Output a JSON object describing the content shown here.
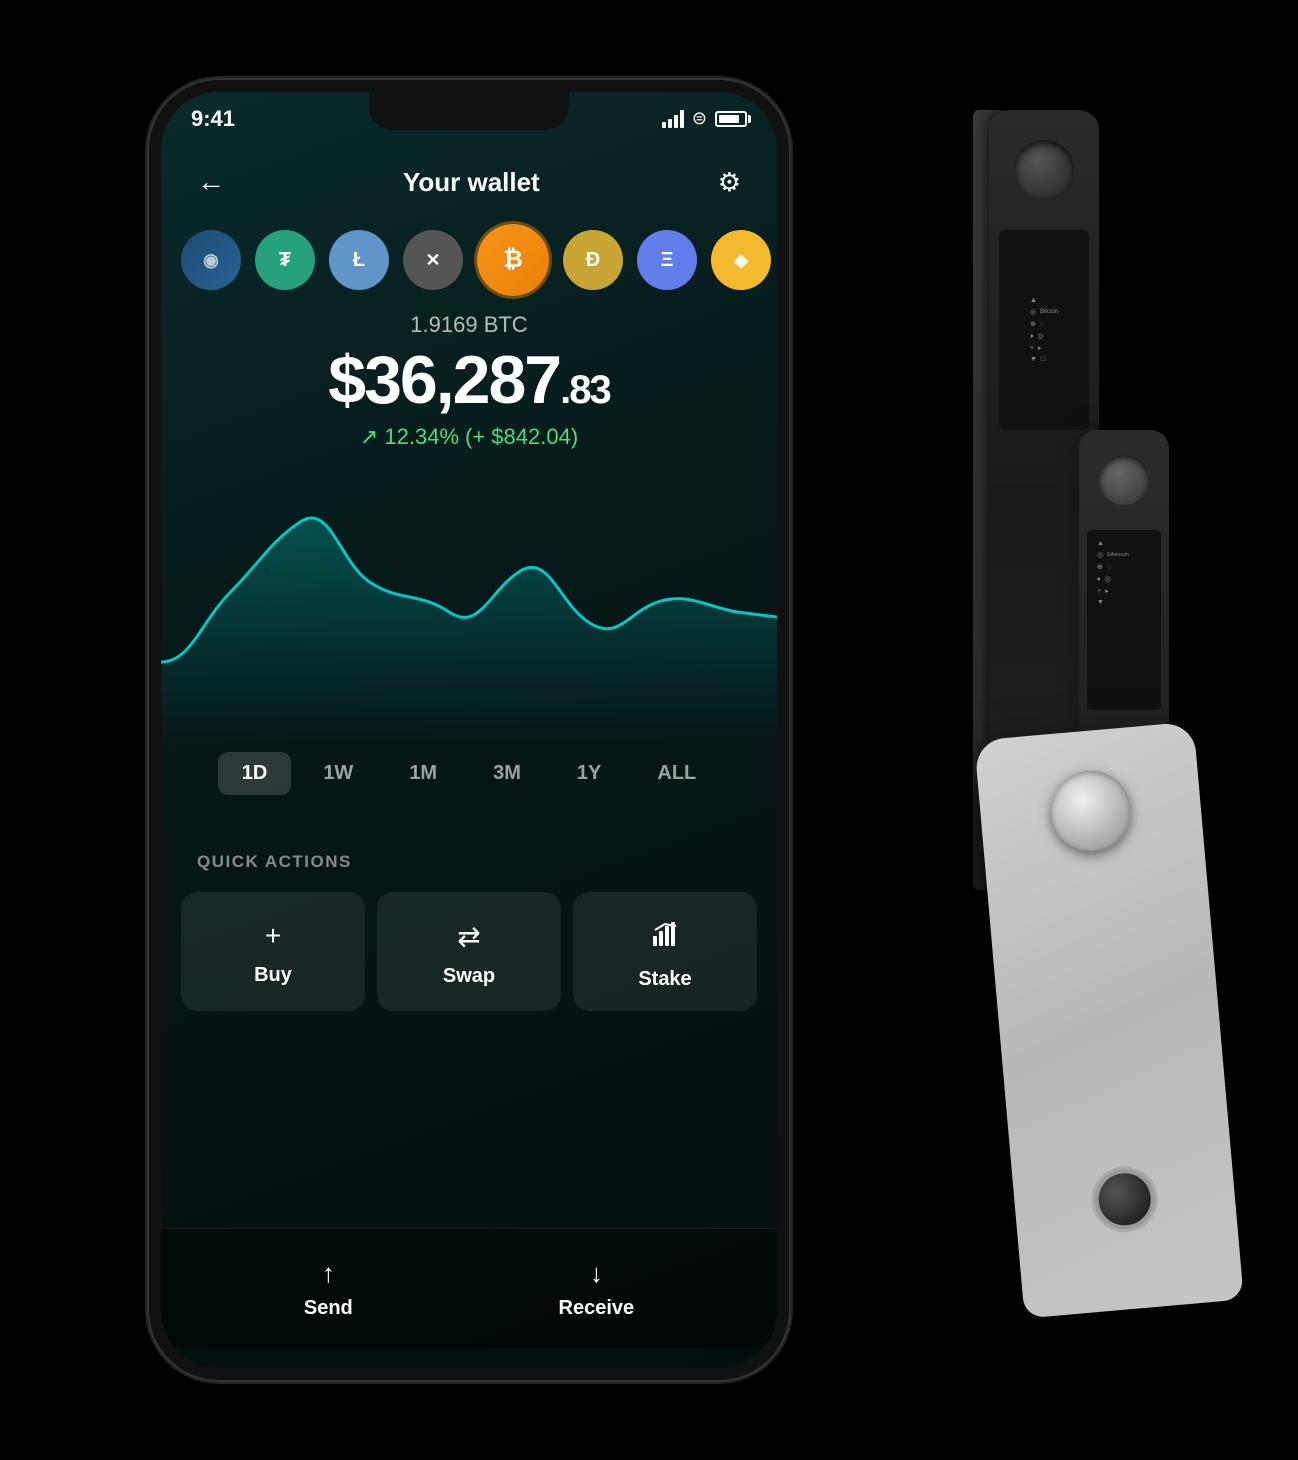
{
  "app": {
    "title": "Your wallet",
    "status_time": "9:41",
    "back_label": "←",
    "settings_label": "⚙"
  },
  "coins": [
    {
      "id": "unknown",
      "symbol": "?",
      "color": "#2a6496",
      "bg": "#1a4a70",
      "active": false
    },
    {
      "id": "usdt",
      "symbol": "₮",
      "color": "#26a17b",
      "bg": "#26a17b",
      "active": false
    },
    {
      "id": "ltc",
      "symbol": "Ł",
      "color": "#5f95c7",
      "bg": "#5f95c7",
      "active": false
    },
    {
      "id": "xrp",
      "symbol": "✕",
      "color": "#aaa",
      "bg": "#555",
      "active": false
    },
    {
      "id": "btc",
      "symbol": "₿",
      "color": "#f7931a",
      "bg": "#f7931a",
      "active": true
    },
    {
      "id": "doge",
      "symbol": "Ð",
      "color": "#c8a535",
      "bg": "#c8a535",
      "active": false
    },
    {
      "id": "eth",
      "symbol": "Ξ",
      "color": "#627eea",
      "bg": "#627eea",
      "active": false
    },
    {
      "id": "bnb",
      "symbol": "◈",
      "color": "#f3ba2f",
      "bg": "#f3ba2f",
      "active": false
    },
    {
      "id": "algo",
      "symbol": "⬡",
      "color": "#888",
      "bg": "#444",
      "active": false
    }
  ],
  "balance": {
    "crypto_amount": "1.9169 BTC",
    "fiat_main": "$36,287",
    "fiat_cents": ".83",
    "change_percent": "↗ 12.34%",
    "change_amount": "(+ $842.04)",
    "change_color": "#4ade80"
  },
  "chart": {
    "color": "#00c8c8",
    "fill_color": "rgba(0,200,200,0.15)"
  },
  "time_periods": [
    {
      "id": "1d",
      "label": "1D",
      "active": true
    },
    {
      "id": "1w",
      "label": "1W",
      "active": false
    },
    {
      "id": "1m",
      "label": "1M",
      "active": false
    },
    {
      "id": "3m",
      "label": "3M",
      "active": false
    },
    {
      "id": "1y",
      "label": "1Y",
      "active": false
    },
    {
      "id": "all",
      "label": "ALL",
      "active": false
    }
  ],
  "quick_actions": {
    "label": "QUICK ACTIONS",
    "buttons": [
      {
        "id": "buy",
        "icon": "+",
        "label": "Buy"
      },
      {
        "id": "swap",
        "icon": "⇄",
        "label": "Swap"
      },
      {
        "id": "stake",
        "icon": "↑↑",
        "label": "Stake"
      }
    ]
  },
  "bottom_nav": [
    {
      "id": "send",
      "icon": "↑",
      "label": "Send"
    },
    {
      "id": "receive",
      "icon": "↓",
      "label": "Receive"
    }
  ]
}
